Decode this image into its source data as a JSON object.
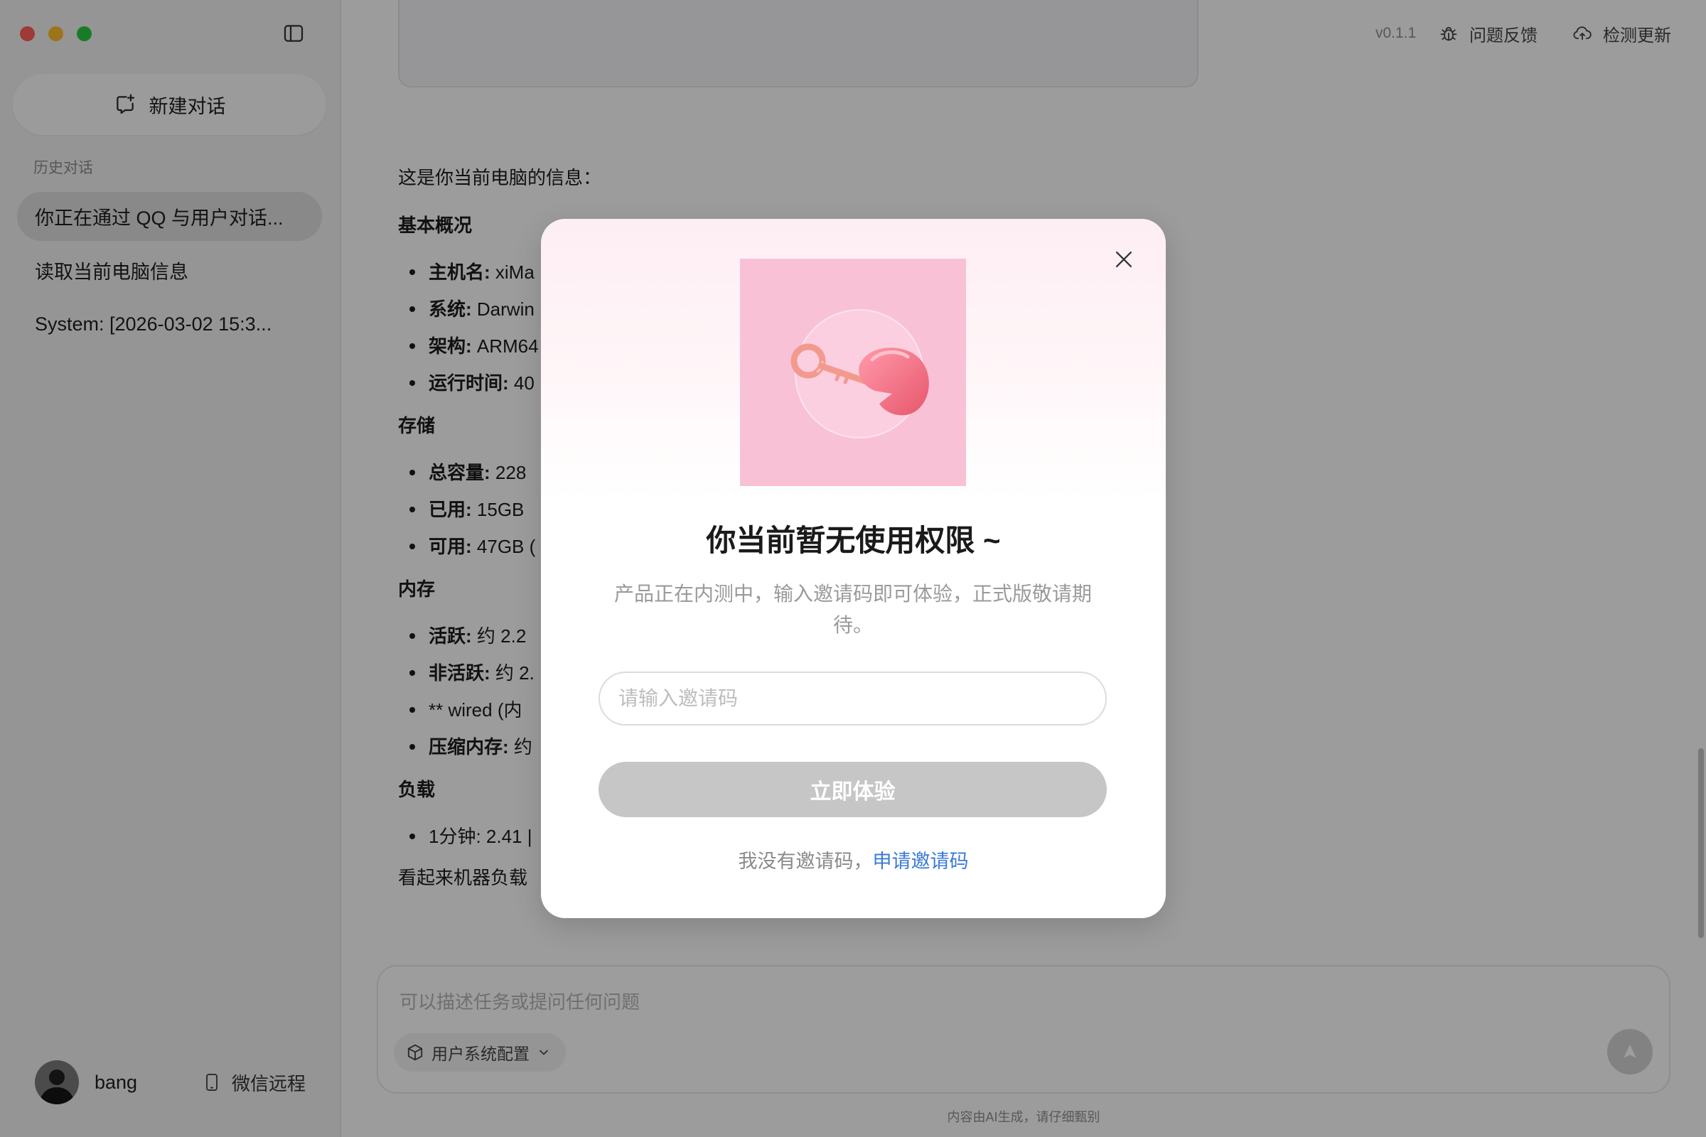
{
  "theme": {
    "overlay": "rgba(0, 0, 0, 0.38)",
    "link": "#3b7bd6",
    "button_disabled": "#c6c6c6",
    "illustration_bg": "#f8c1d6",
    "traffic_red": "#ff5f57",
    "traffic_yellow": "#febc2e",
    "traffic_green": "#28c840"
  },
  "sidebar": {
    "toggle_icon": "sidebar-toggle-icon",
    "new_chat": {
      "icon": "new-chat-icon",
      "label": "新建对话"
    },
    "history_title": "历史对话",
    "history": [
      {
        "label": "你正在通过 QQ 与用户对话...",
        "selected": true
      },
      {
        "label": "读取当前电脑信息",
        "selected": false
      },
      {
        "label": "System: [2026-03-02 15:3...",
        "selected": false
      }
    ],
    "user": {
      "name": "bang",
      "avatar_icon": "user-avatar"
    },
    "wechat_remote": {
      "icon": "phone-icon",
      "label": "微信远程"
    }
  },
  "topbar": {
    "version": "v0.1.1",
    "feedback": {
      "icon": "bug-icon",
      "label": "问题反馈"
    },
    "check_update": {
      "icon": "cloud-upload-icon",
      "label": "检测更新"
    }
  },
  "conversation": {
    "intro": "这是你当前电脑的信息：",
    "sections": [
      {
        "heading": "基本概况",
        "items": [
          {
            "label": "主机名:",
            "value": "xiMa"
          },
          {
            "label": "系统:",
            "value": "Darwin"
          },
          {
            "label": "架构:",
            "value": "ARM64"
          },
          {
            "label": "运行时间:",
            "value": "40"
          }
        ]
      },
      {
        "heading": "存储",
        "items": [
          {
            "label": "总容量:",
            "value": "228"
          },
          {
            "label": "已用:",
            "value": "15GB"
          },
          {
            "label": "可用:",
            "value": "47GB ("
          }
        ]
      },
      {
        "heading": "内存",
        "items": [
          {
            "label": "活跃:",
            "value": "约 2.2"
          },
          {
            "label": "非活跃:",
            "value": "约 2."
          },
          {
            "text": "** wired (内"
          },
          {
            "label": "压缩内存:",
            "value": "约"
          }
        ]
      },
      {
        "heading": "负载",
        "items": [
          {
            "text": "1分钟: 2.41 |"
          }
        ]
      }
    ],
    "closing": "看起来机器负载"
  },
  "composer": {
    "placeholder": "可以描述任务或提问任何问题",
    "config_selector": {
      "icon": "cube-icon",
      "label": "用户系统配置"
    },
    "send_icon": "send-icon",
    "disclaimer": "内容由AI生成，请仔细甄别"
  },
  "modal": {
    "close_icon": "close-icon",
    "illustration": "key-unlock-illustration",
    "title": "你当前暂无使用权限 ~",
    "description": "产品正在内测中，输入邀请码即可体验，正式版敬请期待。",
    "invite_code_input": {
      "placeholder": "请输入邀请码"
    },
    "submit_label": "立即体验",
    "no_code_text": "我没有邀请码，",
    "apply_link": "申请邀请码"
  }
}
